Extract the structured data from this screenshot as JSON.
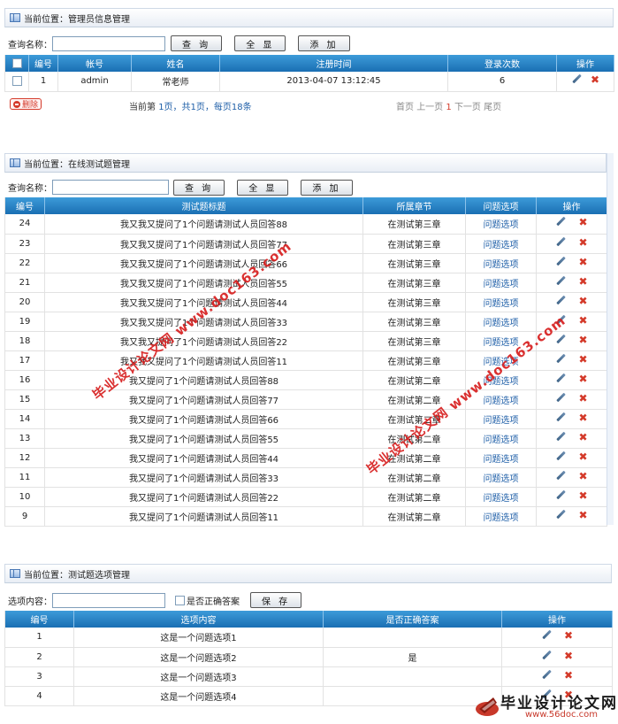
{
  "panel1": {
    "title": "当前位置：管理员信息管理",
    "search_label": "查询名称：",
    "buttons": {
      "query": "查 询",
      "show_all": "全 显",
      "add": "添 加"
    },
    "columns": [
      "编号",
      "帐号",
      "姓名",
      "注册时间",
      "登录次数",
      "操作"
    ],
    "rows": [
      {
        "id": "1",
        "account": "admin",
        "name": "常老师",
        "reg_time": "2013-04-07 13:12:45",
        "logins": "6"
      }
    ],
    "delete_label": "删除",
    "pager_info": {
      "prefix": "当前第",
      "current": "1页，共1页，每页18条"
    },
    "pager_nav": {
      "first": "首页",
      "prev": "上一页",
      "page": "1",
      "next": "下一页",
      "last": "尾页"
    }
  },
  "panel2": {
    "title": "当前位置：在线测试题管理",
    "search_label": "查询名称：",
    "buttons": {
      "query": "查 询",
      "show_all": "全 显",
      "add": "添 加"
    },
    "columns": [
      "编号",
      "测试题标题",
      "所属章节",
      "问题选项",
      "操作"
    ],
    "rows": [
      {
        "id": "24",
        "title": "我又我又提问了1个问题请测试人员回答88",
        "chapter": "在测试第三章",
        "option": "问题选项"
      },
      {
        "id": "23",
        "title": "我又我又提问了1个问题请测试人员回答77",
        "chapter": "在测试第三章",
        "option": "问题选项"
      },
      {
        "id": "22",
        "title": "我又我又提问了1个问题请测试人员回答66",
        "chapter": "在测试第三章",
        "option": "问题选项"
      },
      {
        "id": "21",
        "title": "我又我又提问了1个问题请测试人员回答55",
        "chapter": "在测试第三章",
        "option": "问题选项"
      },
      {
        "id": "20",
        "title": "我又我又提问了1个问题请测试人员回答44",
        "chapter": "在测试第三章",
        "option": "问题选项"
      },
      {
        "id": "19",
        "title": "我又我又提问了1个问题请测试人员回答33",
        "chapter": "在测试第三章",
        "option": "问题选项"
      },
      {
        "id": "18",
        "title": "我又我又提问了1个问题请测试人员回答22",
        "chapter": "在测试第三章",
        "option": "问题选项"
      },
      {
        "id": "17",
        "title": "我又我又提问了1个问题请测试人员回答11",
        "chapter": "在测试第三章",
        "option": "问题选项"
      },
      {
        "id": "16",
        "title": "我又提问了1个问题请测试人员回答88",
        "chapter": "在测试第二章",
        "option": "问题选项"
      },
      {
        "id": "15",
        "title": "我又提问了1个问题请测试人员回答77",
        "chapter": "在测试第二章",
        "option": "问题选项"
      },
      {
        "id": "14",
        "title": "我又提问了1个问题请测试人员回答66",
        "chapter": "在测试第二章",
        "option": "问题选项"
      },
      {
        "id": "13",
        "title": "我又提问了1个问题请测试人员回答55",
        "chapter": "在测试第二章",
        "option": "问题选项"
      },
      {
        "id": "12",
        "title": "我又提问了1个问题请测试人员回答44",
        "chapter": "在测试第二章",
        "option": "问题选项"
      },
      {
        "id": "11",
        "title": "我又提问了1个问题请测试人员回答33",
        "chapter": "在测试第二章",
        "option": "问题选项"
      },
      {
        "id": "10",
        "title": "我又提问了1个问题请测试人员回答22",
        "chapter": "在测试第二章",
        "option": "问题选项"
      },
      {
        "id": "9",
        "title": "我又提问了1个问题请测试人员回答11",
        "chapter": "在测试第二章",
        "option": "问题选项"
      }
    ]
  },
  "panel3": {
    "title": "当前位置：测试题选项管理",
    "option_label": "选项内容：",
    "correct_label": "是否正确答案",
    "save": "保 存",
    "columns": [
      "编号",
      "选项内容",
      "是否正确答案",
      "操作"
    ],
    "rows": [
      {
        "id": "1",
        "content": "这是一个问题选项1",
        "correct": ""
      },
      {
        "id": "2",
        "content": "这是一个问题选项2",
        "correct": "是"
      },
      {
        "id": "3",
        "content": "这是一个问题选项3",
        "correct": ""
      },
      {
        "id": "4",
        "content": "这是一个问题选项4",
        "correct": ""
      }
    ]
  },
  "watermarks": {
    "wm1": "毕业设计论文网 www.doc163.com",
    "wm2": "毕业设计论文网 www.doc163.com"
  },
  "logo": {
    "name": "毕业设计论文网",
    "url": "www.56doc.com"
  },
  "colors": {
    "header_blue": "#2a86c8",
    "link_blue": "#1f5fa8",
    "delete_red": "#d43a2a",
    "watermark_red": "#d71f1f"
  }
}
